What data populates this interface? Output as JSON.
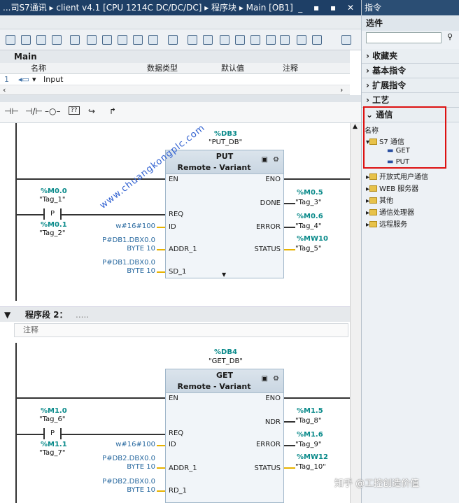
{
  "title": "...司S7通讯 ▸ client v4.1 [CPU 1214C DC/DC/DC] ▸ 程序块 ▸ Main [OB1]",
  "window_btns": "_ ▪ ▪ ✕",
  "interface": {
    "block_name": "Main",
    "col_name": "名称",
    "col_type": "数据类型",
    "col_default": "默认值",
    "col_comment": "注释",
    "row_num": "1",
    "row_name": "Input"
  },
  "ladder_symbols": [
    "⊣⊢",
    "⊣/⊢",
    "–○–",
    "??",
    "↪",
    "↱"
  ],
  "network1": {
    "db": "%DB3",
    "db_sym": "\"PUT_DB\"",
    "block": "PUT",
    "sub": "Remote - Variant",
    "pins": {
      "en": "EN",
      "eno": "ENO",
      "req": "REQ",
      "id": "ID",
      "addr": "ADDR_1",
      "sd": "SD_1",
      "done": "DONE",
      "error": "ERROR",
      "status": "STATUS"
    },
    "m0": "%M0.0",
    "m0s": "\"Tag_1\"",
    "p": "P",
    "m1": "%M0.1",
    "m1s": "\"Tag_2\"",
    "id_val": "w#16#100",
    "addr1": "P#DB1.DBX0.0",
    "addr2": "BYTE 10",
    "sd1": "P#DB1.DBX0.0",
    "sd2": "BYTE 10",
    "done_tag": "%M0.5",
    "done_sym": "\"Tag_3\"",
    "err_tag": "%M0.6",
    "err_sym": "\"Tag_4\"",
    "st_tag": "%MW10",
    "st_sym": "\"Tag_5\""
  },
  "network2": {
    "label": "程序段 2：",
    "dots": ".....",
    "comment": "注释",
    "db": "%DB4",
    "db_sym": "\"GET_DB\"",
    "block": "GET",
    "sub": "Remote - Variant",
    "pins": {
      "en": "EN",
      "eno": "ENO",
      "req": "REQ",
      "id": "ID",
      "addr": "ADDR_1",
      "rd": "RD_1",
      "ndr": "NDR",
      "error": "ERROR",
      "status": "STATUS"
    },
    "m0": "%M1.0",
    "m0s": "\"Tag_6\"",
    "p": "P",
    "m1": "%M1.1",
    "m1s": "\"Tag_7\"",
    "id_val": "w#16#100",
    "addr1": "P#DB2.DBX0.0",
    "addr2": "BYTE 10",
    "rd1": "P#DB2.DBX0.0",
    "rd2": "BYTE 10",
    "ndr_tag": "%M1.5",
    "ndr_sym": "\"Tag_8\"",
    "err_tag": "%M1.6",
    "err_sym": "\"Tag_9\"",
    "st_tag": "%MW12",
    "st_sym": "\"Tag_10\""
  },
  "panel": {
    "title": "指令",
    "options": "选件",
    "sections": [
      "收藏夹",
      "基本指令",
      "扩展指令",
      "工艺",
      "通信"
    ],
    "col_name": "名称",
    "tree": {
      "s7": "S7 通信",
      "get": "GET",
      "put": "PUT",
      "open": "开放式用户通信",
      "web": "WEB 服务器",
      "other": "其他",
      "cp": "通信处理器",
      "remote": "远程服务"
    }
  },
  "watermark": "www.chuangkongplc.com",
  "credit": "知乎 @工控创造价值"
}
